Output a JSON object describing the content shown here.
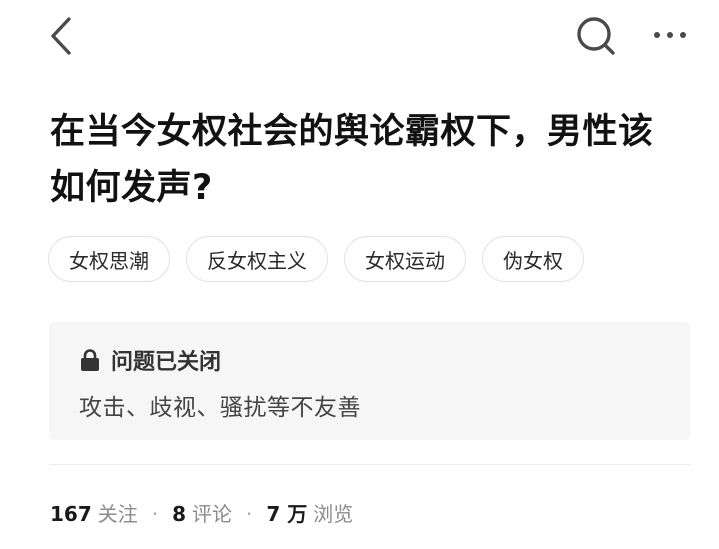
{
  "nav": {
    "back_icon": "chevron-left-icon",
    "search_icon": "search-icon",
    "more_icon": "more-horizontal-icon"
  },
  "question": {
    "title": "在当今女权社会的舆论霸权下，男性该如何发声?"
  },
  "tags": [
    {
      "label": "女权思潮"
    },
    {
      "label": "反女权主义"
    },
    {
      "label": "女权运动"
    },
    {
      "label": "伪女权"
    }
  ],
  "notice": {
    "icon": "lock-icon",
    "title": "问题已关闭",
    "reason": "攻击、歧视、骚扰等不友善"
  },
  "stats": {
    "followers_count": "167",
    "followers_label": "关注",
    "separator": "·",
    "comments_count": "8",
    "comments_label": "评论",
    "views_count": "7 万",
    "views_label": "浏览"
  },
  "colors": {
    "background": "#ffffff",
    "title_text": "#121212",
    "notice_bg": "#f6f6f6",
    "muted_text": "#8c8c8c"
  }
}
